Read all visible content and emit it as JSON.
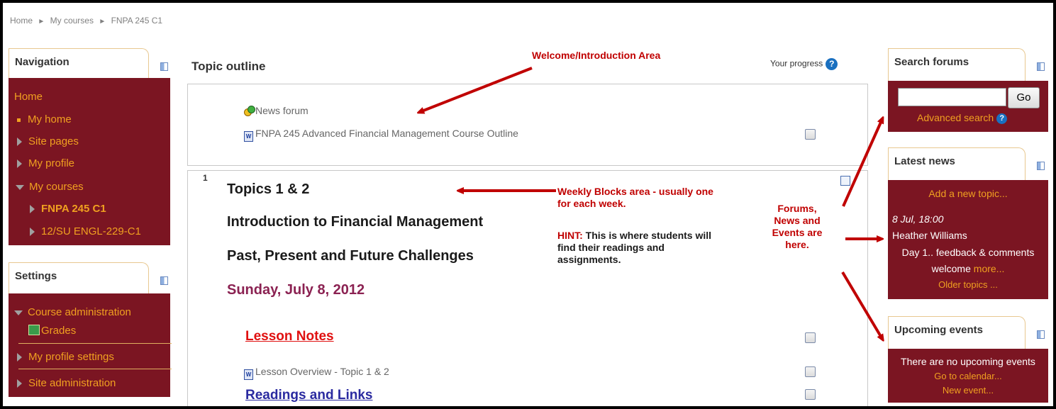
{
  "breadcrumb": {
    "items": [
      "Home",
      "My courses",
      "FNPA 245 C1"
    ],
    "sep": "►"
  },
  "navigation": {
    "title": "Navigation",
    "home": "Home",
    "my_home": "My home",
    "site_pages": "Site pages",
    "my_profile": "My profile",
    "my_courses": "My courses",
    "course_current": "FNPA 245 C1",
    "course_other": "12/SU ENGL-229-C1"
  },
  "settings": {
    "title": "Settings",
    "course_admin": "Course administration",
    "grades": "Grades",
    "profile_settings": "My profile settings",
    "site_admin": "Site administration"
  },
  "main": {
    "title": "Topic outline",
    "progress_label": "Your progress",
    "help_glyph": "?",
    "news_forum": "News forum",
    "course_outline": "FNPA 245 Advanced Financial Management Course Outline",
    "section_number": "1",
    "topic_title": "Topics 1 & 2",
    "topic_line2": "Introduction to Financial Management",
    "topic_line3": "Past, Present and Future Challenges",
    "topic_date": "Sunday, July 8, 2012",
    "lesson_notes": "Lesson Notes",
    "lesson_overview": "Lesson Overview - Topic 1 & 2",
    "readings_links": "Readings and Links"
  },
  "annotations": {
    "welcome": "Welcome/Introduction Area",
    "weekly_line1": "Weekly Blocks area - usually one",
    "weekly_line2": "for each week.",
    "hint_label": "HINT:",
    "hint_line1": " This is where students will",
    "hint_line2": "find their readings and",
    "hint_line3": "assignments.",
    "forums_line1": "Forums,",
    "forums_line2": "News and",
    "forums_line3": "Events are",
    "forums_line4": "here."
  },
  "search_forums": {
    "title": "Search forums",
    "go_label": "Go",
    "advanced": "Advanced search"
  },
  "latest_news": {
    "title": "Latest news",
    "add_topic": "Add a new topic...",
    "date": "8 Jul, 18:00",
    "author": "Heather Williams",
    "summary_line1": "Day 1.. feedback & comments",
    "summary_line2": "welcome",
    "more": "more...",
    "older": "Older topics ..."
  },
  "upcoming_events": {
    "title": "Upcoming events",
    "none": "There are no upcoming events",
    "calendar": "Go to calendar...",
    "new_event": "New event..."
  },
  "colors": {
    "block_bg": "#7b1522",
    "link_orange": "#f0a020",
    "annotation_red": "#c00000"
  }
}
